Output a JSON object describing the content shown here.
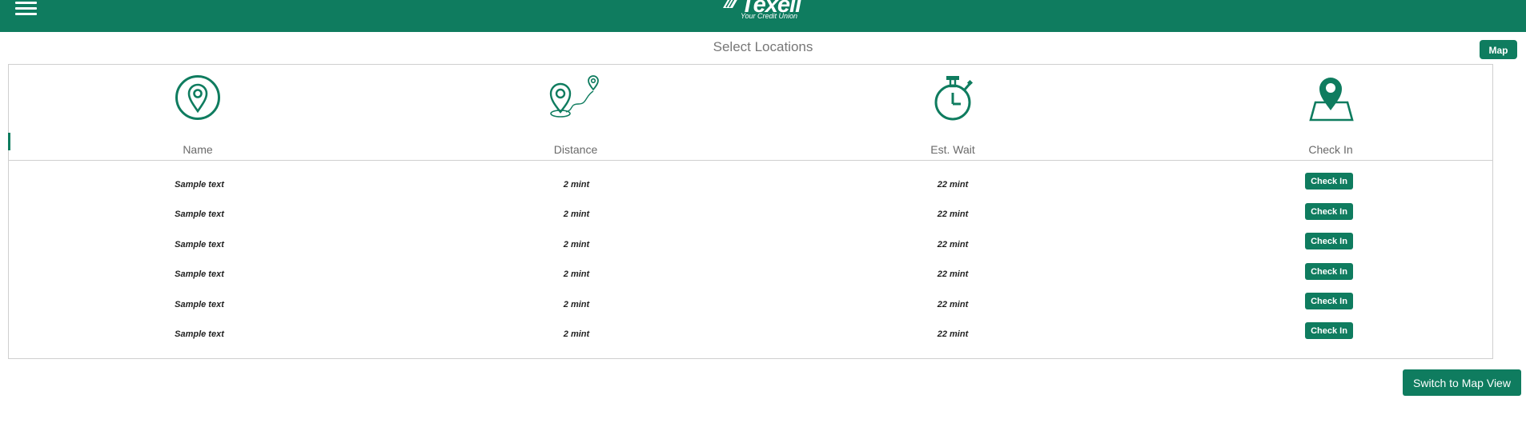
{
  "header": {
    "menu_icon": "hamburger-menu-icon",
    "logo_text": "Texell",
    "logo_tagline": "Your Credit Union"
  },
  "page": {
    "title": "Select Locations",
    "map_button": "Map",
    "switch_button": "Switch to Map View"
  },
  "columns": [
    {
      "label": "Name",
      "icon": "location-pin-icon"
    },
    {
      "label": "Distance",
      "icon": "route-pins-icon"
    },
    {
      "label": "Est. Wait",
      "icon": "stopwatch-icon"
    },
    {
      "label": "Check In",
      "icon": "map-pin-checkin-icon"
    }
  ],
  "rows": [
    {
      "name": "Sample text",
      "distance": "2 mint",
      "wait": "22 mint",
      "action": "Check In"
    },
    {
      "name": "Sample text",
      "distance": "2 mint",
      "wait": "22 mint",
      "action": "Check In"
    },
    {
      "name": "Sample text",
      "distance": "2 mint",
      "wait": "22 mint",
      "action": "Check In"
    },
    {
      "name": "Sample text",
      "distance": "2 mint",
      "wait": "22 mint",
      "action": "Check In"
    },
    {
      "name": "Sample text",
      "distance": "2 mint",
      "wait": "22 mint",
      "action": "Check In"
    },
    {
      "name": "Sample text",
      "distance": "2 mint",
      "wait": "22 mint",
      "action": "Check In"
    }
  ],
  "colors": {
    "brand": "#0f7c5f",
    "title_text": "#777777",
    "border": "#cfcfcf"
  }
}
